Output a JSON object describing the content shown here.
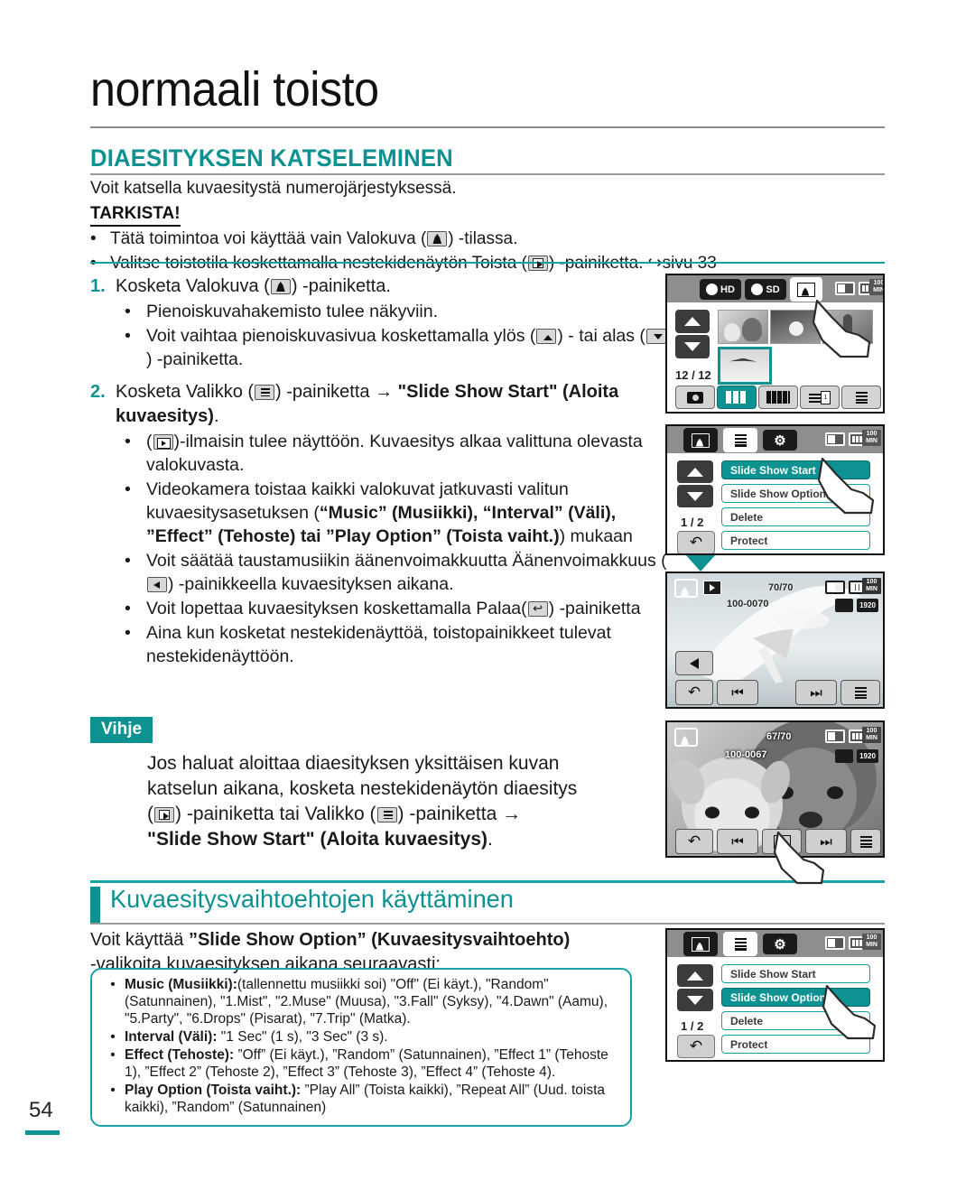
{
  "header": {
    "chapter_title": "normaali toisto",
    "section_title": "DIAESITYKSEN KATSELEMINEN",
    "intro": "Voit katsella kuvaesitystä numerojärjestyksessä.",
    "check_label": "TARKISTA!"
  },
  "checks": [
    {
      "bullet": "•",
      "pre": "Tätä toimintoa voi käyttää vain Valokuva (",
      "icon": "photo-mode-icon",
      "post": ") -tilassa."
    },
    {
      "bullet": "•",
      "pre": "Valitse toistotila koskettamalla nestekidenäytön Toista (",
      "icon": "play-mode-icon",
      "post": ") -painiketta. ↪sivu 33"
    }
  ],
  "steps": {
    "step1_num": "1.",
    "step1_pre": "Kosketa Valokuva (",
    "step1_post": ") -painiketta.",
    "step1_subs": [
      "Pienoiskuvahakemisto tulee näkyviin.",
      "Voit vaihtaa pienoiskuvasivua koskettamalla ylös ( ) - tai alas ( ) -painiketta."
    ],
    "step1_sub2_a": "Voit vaihtaa pienoiskuvasivua koskettamalla ylös (",
    "step1_sub2_b": ") - tai alas (",
    "step1_sub2_c": ") -painiketta.",
    "step2_num": "2.",
    "step2_a": "Kosketa Valikko (",
    "step2_b": ") -painiketta ",
    "step2_arrow": "→",
    "step2_bold": "\"Slide Show Start\" (Aloita kuvaesitys)",
    "step2_end": ".",
    "step2_sub1_a": "(",
    "step2_sub1_b": ")-ilmaisin tulee näyttöön. Kuvaesitys alkaa valittuna olevasta valokuvasta.",
    "step2_sub2_a": "Videokamera toistaa kaikki valokuvat jatkuvasti valitun kuvaesitysasetuksen (",
    "step2_sub2_bold1": "“Music” (Musiikki), “Interval” (Väli), ”Effect” (Tehoste) tai ”Play Option” (Toista vaiht.)",
    "step2_sub2_c": ") mukaan",
    "step2_sub3_a": "Voit säätää taustamusiikin äänenvoimakkuutta Äänenvoimakkuus (",
    "step2_sub3_b": ") -painikkeella kuvaesityksen aikana.",
    "step2_sub4_a": "Voit lopettaa kuvaesityksen koskettamalla Palaa(",
    "step2_sub4_b": ") -painiketta",
    "step2_sub5": "Aina kun kosketat nestekidenäyttöä, toistopainikkeet tulevat nestekidenäyttöön."
  },
  "tip": {
    "label": "Vihje",
    "line1": "Jos haluat aloittaa diaesityksen yksittäisen kuvan",
    "line2": "katselun aikana, kosketa nestekidenäytön diaesitys",
    "line3_a": "(",
    "line3_b": ") -painiketta tai Valikko (",
    "line3_c": ") -painiketta →",
    "line4_bold": "\"Slide Show Start\" (Aloita kuvaesitys)",
    "line4_end": "."
  },
  "subsection": {
    "title": "Kuvaesitysvaihtoehtojen käyttäminen",
    "intro_a": "Voit käyttää ",
    "intro_bold": "”Slide Show Option” (Kuvaesitysvaihtoehto)",
    "intro_b": "-valikoita kuvaesityksen aikana seuraavasti:"
  },
  "options": [
    {
      "bullet": "•",
      "label": "Music (Musiikki):",
      "value": "(tallennettu musiikki soi) \"Off\" (Ei käyt.), \"Random\" (Satunnainen), \"1.Mist\", \"2.Muse\" (Muusa), \"3.Fall\" (Syksy), \"4.Dawn\" (Aamu), \"5.Party\", \"6.Drops\" (Pisarat), \"7.Trip\" (Matka)."
    },
    {
      "bullet": "•",
      "label": "Interval (Väli):",
      "value": " \"1 Sec\" (1 s), \"3 Sec\" (3 s)."
    },
    {
      "bullet": "•",
      "label": "Effect (Tehoste):",
      "value": " ”Off” (Ei käyt.), ”Random” (Satunnainen), ”Effect 1” (Tehoste 1), ”Effect 2” (Tehoste 2), ”Effect 3” (Tehoste 3), ”Effect 4” (Tehoste 4)."
    },
    {
      "bullet": "•",
      "label": "Play Option (Toista vaiht.):",
      "value": " ”Play All” (Toista kaikki), ”Repeat All” (Uud. toista kaikki), ”Random” (Satunnainen)"
    }
  ],
  "screens": {
    "thumbnail_index": {
      "tab_hd": "HD",
      "tab_sd": "SD",
      "min_label": "100\nMIN",
      "counter": "12 / 12"
    },
    "menu_start": {
      "items": [
        "Slide Show Start",
        "Slide Show Option",
        "Delete",
        "Protect"
      ],
      "page": "1 / 2",
      "highlighted": "Slide Show Start"
    },
    "slideshow_play": {
      "counter": "70/70",
      "file": "100-0070",
      "min_label": "100\nMIN",
      "quality": "1920"
    },
    "photo_view": {
      "counter": "67/70",
      "file": "100-0067",
      "min_label": "100\nMIN",
      "quality": "1920"
    },
    "menu_option": {
      "items": [
        "Slide Show Start",
        "Slide Show Option",
        "Delete",
        "Protect"
      ],
      "page": "1 / 2",
      "highlighted": "Slide Show Option"
    }
  },
  "footer": {
    "page_number": "54"
  },
  "colors": {
    "teal": "#0d9191",
    "teal_rule": "#17a3a3",
    "grey_rule": "#9a9a9a"
  }
}
